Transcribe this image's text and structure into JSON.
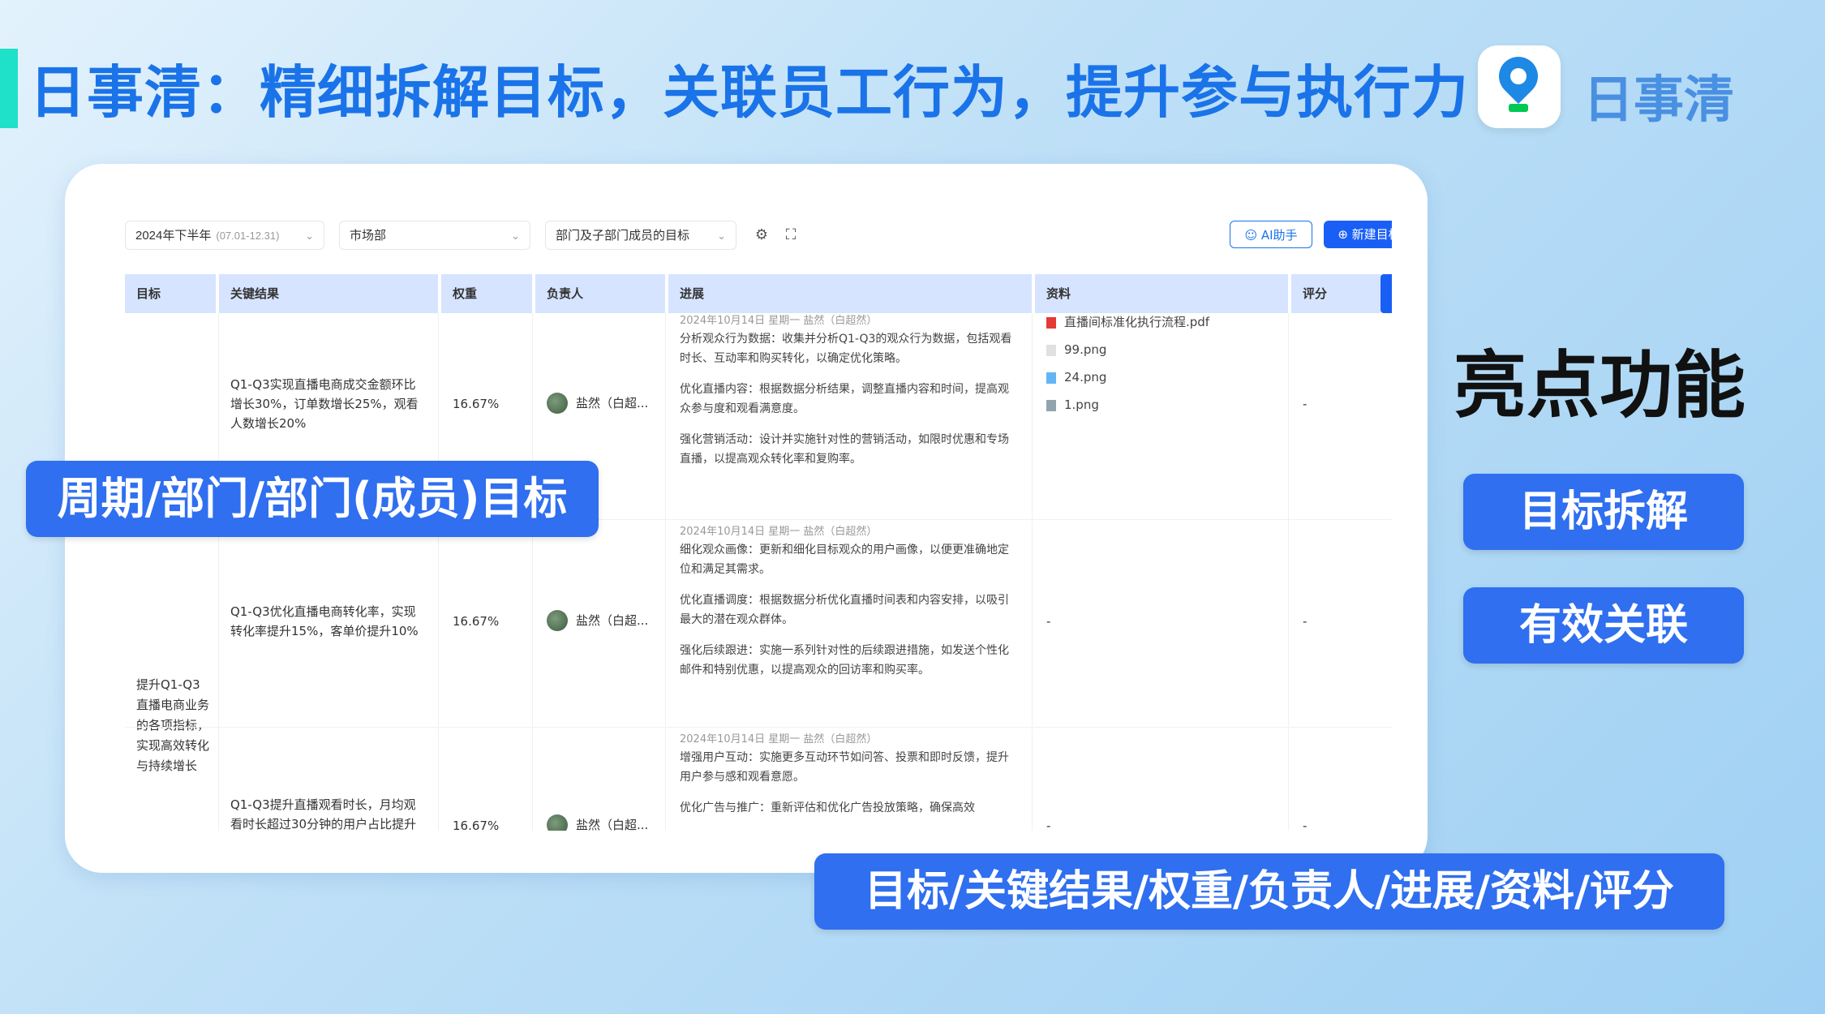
{
  "header": {
    "title": "日事清：精细拆解目标，关联员工行为，提升参与执行力",
    "brand": "日事清"
  },
  "filters": {
    "period": "2024年下半年",
    "period_range": "(07.01-12.31)",
    "department": "市场部",
    "scope": "部门及子部门成员的目标",
    "ai_button": "AI助手",
    "new_button": "新建目标"
  },
  "columns": [
    "目标",
    "关键结果",
    "权重",
    "负责人",
    "进展",
    "资料",
    "评分"
  ],
  "goal": "提升Q1-Q3直播电商业务的各项指标，实现高效转化与持续增长",
  "rows": [
    {
      "kr": "Q1-Q3实现直播电商成交金额环比增长30%，订单数增长25%，观看人数增长20%",
      "weight": "16.67%",
      "owner": "盐然（白超...",
      "date": "2024年10月14日  星期一  盐然（白超然）",
      "progress": [
        "分析观众行为数据：收集并分析Q1-Q3的观众行为数据，包括观看时长、互动率和购买转化，以确定优化策略。",
        "优化直播内容：根据数据分析结果，调整直播内容和时间，提高观众参与度和观看满意度。",
        "强化营销活动：设计并实施针对性的营销活动，如限时优惠和专场直播，以提高观众转化率和复购率。"
      ],
      "files": [
        "直播间标准化执行流程.pdf",
        "99.png",
        "24.png",
        "1.png"
      ],
      "score": "-"
    },
    {
      "kr": "Q1-Q3优化直播电商转化率，实现转化率提升15%，客单价提升10%",
      "weight": "16.67%",
      "owner": "盐然（白超...",
      "date": "2024年10月14日  星期一  盐然（白超然）",
      "progress": [
        "细化观众画像：更新和细化目标观众的用户画像，以便更准确地定位和满足其需求。",
        "优化直播调度：根据数据分析优化直播时间表和内容安排，以吸引最大的潜在观众群体。",
        "强化后续跟进：实施一系列针对性的后续跟进措施，如发送个性化邮件和特别优惠，以提高观众的回访率和购买率。"
      ],
      "files_empty": "-",
      "score": "-"
    },
    {
      "kr": "Q1-Q3提升直播观看时长，月均观看时长超过30分钟的用户占比提升",
      "weight": "16.67%",
      "owner": "盐然（白超...",
      "date": "2024年10月14日  星期一  盐然（白超然）",
      "progress": [
        "增强用户互动：实施更多互动环节如问答、投票和即时反馈，提升用户参与感和观看意愿。",
        "优化广告与推广：重新评估和优化广告投放策略，确保高效"
      ],
      "files_empty": "-",
      "score": "-"
    }
  ],
  "labels": {
    "left_pill": "周期/部门/部门(成员)目标",
    "features_title": "亮点功能",
    "feature1": "目标拆解",
    "feature2": "有效关联",
    "bottom_pill": "目标/关键结果/权重/负责人/进展/资料/评分"
  },
  "colors": {
    "accent": "#1a73e8",
    "pill": "#2f6ff0",
    "header_bg": "#d6e4ff",
    "teal": "#1fe0c8"
  }
}
